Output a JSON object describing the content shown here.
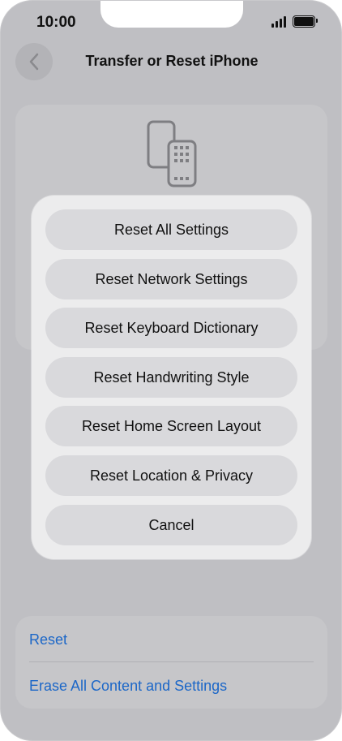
{
  "status_bar": {
    "time": "10:00"
  },
  "header": {
    "title": "Transfer or Reset iPhone",
    "back_icon": "chevron-left-icon"
  },
  "reset_sheet": {
    "options": [
      "Reset All Settings",
      "Reset Network Settings",
      "Reset Keyboard Dictionary",
      "Reset Handwriting Style",
      "Reset Home Screen Layout",
      "Reset Location & Privacy"
    ],
    "cancel_label": "Cancel"
  },
  "actions": {
    "reset_label": "Reset",
    "erase_label": "Erase All Content and Settings"
  },
  "colors": {
    "link": "#1c67c8",
    "background": "#bfbfc3"
  }
}
